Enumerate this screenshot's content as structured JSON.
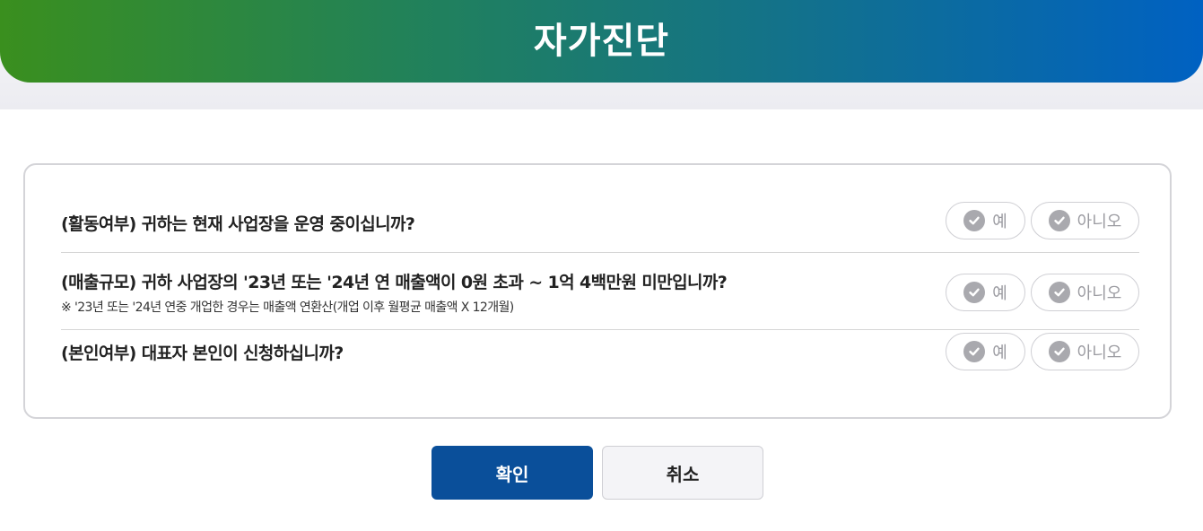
{
  "header": {
    "title": "자가진단"
  },
  "questions": [
    {
      "text": "(활동여부) 귀하는 현재 사업장을 운영 중이십니까?",
      "yes_label": "예",
      "no_label": "아니오"
    },
    {
      "text": "(매출규모) 귀하 사업장의 '23년 또는 '24년 연 매출액이 0원 초과 ~ 1억 4백만원 미만입니까?",
      "note": "※ '23년 또는 '24년 연중 개업한 경우는 매출액 연환산(개업 이후 월평균 매출액 X 12개월)",
      "yes_label": "예",
      "no_label": "아니오"
    },
    {
      "text": "(본인여부) 대표자 본인이 신청하십니까?",
      "yes_label": "예",
      "no_label": "아니오"
    }
  ],
  "buttons": {
    "confirm": "확인",
    "cancel": "취소"
  },
  "colors": {
    "header_gradient": [
      "#3a8f1e",
      "#0061c2"
    ],
    "confirm_bg": "#0a4f9a",
    "option_text": "#9a9aa0"
  },
  "icons": {
    "option_icon": "check-circle-icon"
  }
}
